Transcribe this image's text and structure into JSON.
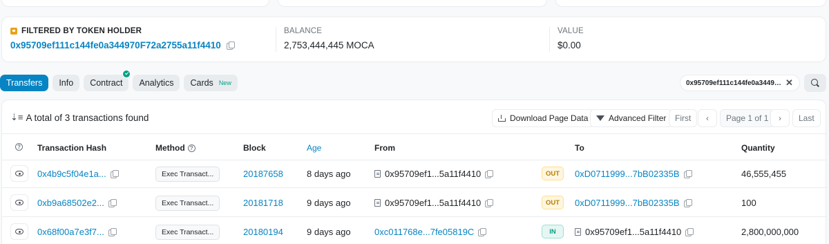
{
  "holder": {
    "filter_label": "FILTERED BY TOKEN HOLDER",
    "address": "0x95709ef111c144fe0a344970F72a2755a11f4410",
    "balance_label": "BALANCE",
    "balance": "2,753,444,445 MOCA",
    "value_label": "VALUE",
    "value": "$0.00"
  },
  "tabs": [
    {
      "label": "Transfers",
      "active": true
    },
    {
      "label": "Info"
    },
    {
      "label": "Contract"
    },
    {
      "label": "Analytics"
    },
    {
      "label": "Cards",
      "badge": "New"
    }
  ],
  "filter_chip": {
    "text": "0x95709ef111c144fe0a34497..."
  },
  "toolbar": {
    "summary": "A total of 3 transactions found",
    "download": "Download Page Data",
    "advanced_filter": "Advanced Filter",
    "first": "First",
    "page": "Page 1 of 1",
    "last": "Last"
  },
  "columns": {
    "hash": "Transaction Hash",
    "method": "Method",
    "block": "Block",
    "age": "Age",
    "from": "From",
    "to": "To",
    "quantity": "Quantity"
  },
  "rows": [
    {
      "hash": "0x4b9c5f04e1a...",
      "method": "Exec Transact...",
      "block": "20187658",
      "age": "8 days ago",
      "from": "0x95709ef1...5a11f4410",
      "direction": "OUT",
      "to": "0xD0711999...7bB02335B",
      "quantity": "46,555,455"
    },
    {
      "hash": "0xb9a68502e2...",
      "method": "Exec Transact...",
      "block": "20181718",
      "age": "9 days ago",
      "from": "0x95709ef1...5a11f4410",
      "direction": "OUT",
      "to": "0xD0711999...7bB02335B",
      "quantity": "100"
    },
    {
      "hash": "0x68f00a7e3f7...",
      "method": "Exec Transact...",
      "block": "20180194",
      "age": "9 days ago",
      "from": "0xc011768e...7fe05819C",
      "direction": "IN",
      "to": "0x95709ef1...5a11f4410",
      "quantity": "2,800,000,000"
    }
  ],
  "colors": {
    "accent": "#0784c3",
    "out": "#b47d00",
    "in": "#00a186"
  }
}
